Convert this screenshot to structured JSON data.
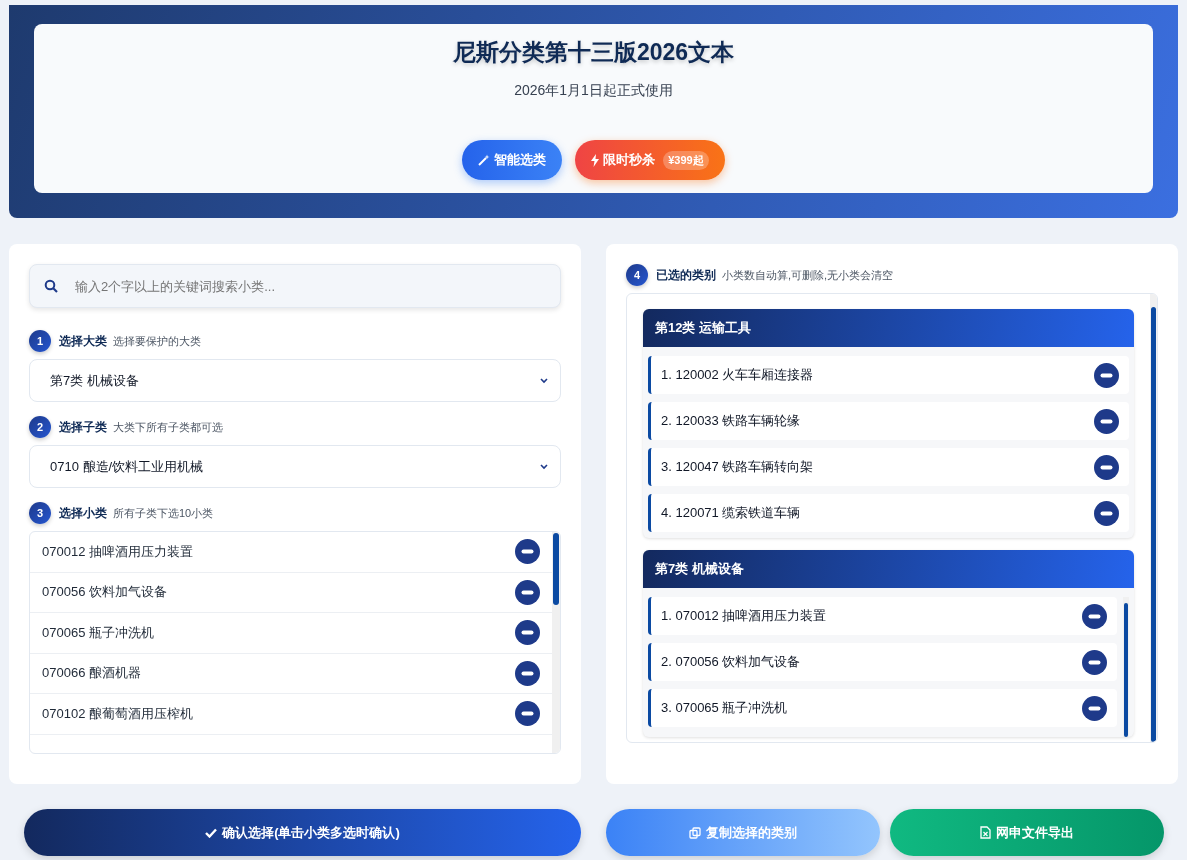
{
  "header": {
    "title": "尼斯分类第十三版2026文本",
    "subtitle": "2026年1月1日起正式使用",
    "buttons": [
      {
        "kind": "smart",
        "label": "智能选类"
      },
      {
        "kind": "sale",
        "label": "限时秒杀",
        "badge": "¥399起"
      }
    ]
  },
  "search": {
    "placeholder": "输入2个字以上的关键词搜索小类..."
  },
  "steps": [
    {
      "number": "1",
      "title": "选择大类",
      "hint": "选择要保护的大类",
      "value": "第7类 机械设备"
    },
    {
      "number": "2",
      "title": "选择子类",
      "hint": "大类下所有子类都可选",
      "value": "0710 酿造/饮料工业用机械"
    },
    {
      "number": "3",
      "title": "选择小类",
      "hint": "所有子类下选10小类"
    }
  ],
  "items": [
    {
      "label": "070012 抽啤酒用压力装置",
      "selected": true
    },
    {
      "label": "070056 饮料加气设备",
      "selected": true
    },
    {
      "label": "070065 瓶子冲洗机",
      "selected": true
    },
    {
      "label": "070066 酿酒机器",
      "selected": true
    },
    {
      "label": "070102 酿葡萄酒用压榨机",
      "selected": true
    }
  ],
  "selected_panel": {
    "number": "4",
    "title": "已选的类别",
    "hint": "小类数自动算,可删除,无小类会清空",
    "groups": [
      {
        "title": "第12类 运输工具",
        "items": [
          "1. 120002 火车车厢连接器",
          "2. 120033 铁路车辆轮缘",
          "3. 120047 铁路车辆转向架",
          "4. 120071 缆索铁道车辆"
        ]
      },
      {
        "title": "第7类 机械设备",
        "items": [
          "1. 070012 抽啤酒用压力装置",
          "2. 070056 饮料加气设备",
          "3. 070065 瓶子冲洗机"
        ]
      }
    ]
  },
  "actions": [
    {
      "kind": "confirm",
      "label": "确认选择(单击小类多选时确认)"
    },
    {
      "kind": "copy",
      "label": "复制选择的类别"
    },
    {
      "kind": "export",
      "label": "网申文件导出"
    }
  ]
}
